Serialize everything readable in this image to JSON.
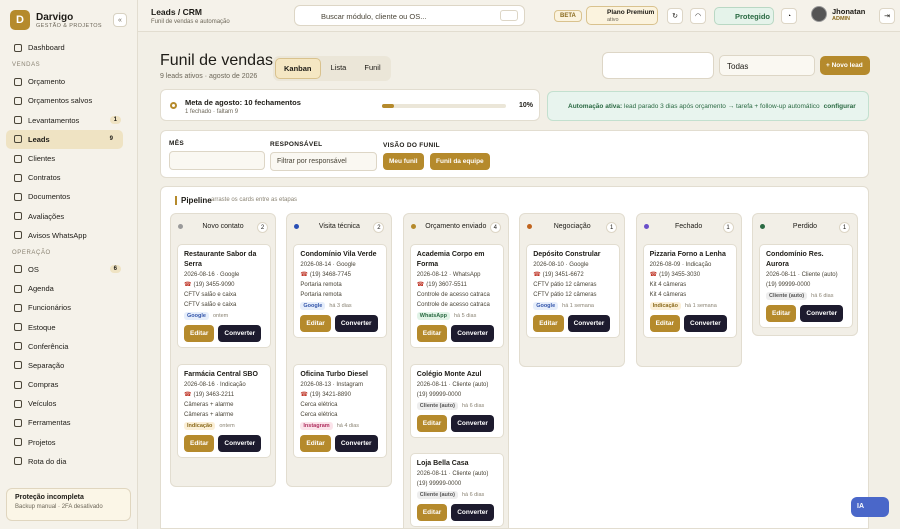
{
  "brand": {
    "name": "Darvigo",
    "sub": "GESTÃO & PROJETOS",
    "logo": "D"
  },
  "sidebar": {
    "top": [
      {
        "label": "Dashboard"
      }
    ],
    "sec1": "VENDAS",
    "vendas": [
      {
        "label": "Orçamento"
      },
      {
        "label": "Orçamentos salvos"
      },
      {
        "label": "Levantamentos",
        "count": "1"
      },
      {
        "label": "Leads",
        "count": "9",
        "active": true
      },
      {
        "label": "Clientes"
      },
      {
        "label": "Contratos"
      },
      {
        "label": "Documentos"
      },
      {
        "label": "Avaliações"
      },
      {
        "label": "Avisos WhatsApp"
      }
    ],
    "sec2": "OPERAÇÃO",
    "operacao": [
      {
        "label": "OS",
        "count": "6"
      },
      {
        "label": "Agenda"
      },
      {
        "label": "Funcionários"
      },
      {
        "label": "Estoque"
      },
      {
        "label": "Conferência"
      },
      {
        "label": "Separação"
      },
      {
        "label": "Compras"
      },
      {
        "label": "Veículos"
      },
      {
        "label": "Ferramentas"
      },
      {
        "label": "Projetos"
      },
      {
        "label": "Rota do dia"
      }
    ],
    "protect_title": "Proteção incompleta",
    "protect_sub": "Backup manual · 2FA desativado"
  },
  "topbar": {
    "crumb": "Leads / CRM",
    "crumb_sub": "Funil de vendas e automação",
    "search": "Buscar módulo, cliente ou OS...",
    "beta": "BETA",
    "plan": "Plano Premium",
    "plan_sub": "ativo",
    "protected": "Protegido",
    "user": "Jhonatan",
    "role": "ADMIN"
  },
  "page": {
    "title": "Funil de vendas",
    "sub": "9 leads ativos · agosto de 2026",
    "tabs": [
      "Kanban",
      "Lista",
      "Funil"
    ],
    "filter": "Todas",
    "new": "+ Novo lead"
  },
  "meta": {
    "title": "Meta de agosto: 10 fechamentos",
    "sub": "1 fechado · faltam 9",
    "pct": "10%",
    "progress": 0.1
  },
  "auto": {
    "bold": "Automação ativa:",
    "text": " lead parado 3 dias após orçamento → tarefa + follow-up automático",
    "link": "configurar"
  },
  "filters": {
    "mes": "MÊS",
    "resp": "RESPONSÁVEL",
    "resp_ph": "Filtrar por responsável",
    "visao": "VISÃO DO FUNIL",
    "meu": "Meu funil",
    "equipe": "Funil da equipe"
  },
  "pipeline": {
    "title": "Pipeline",
    "hint": "arraste os cards entre as etapas",
    "edit": "Editar",
    "convert": "Converter",
    "cols": [
      {
        "name": "Novo contato",
        "count": "2",
        "color": "#9a9a9a",
        "cards": [
          {
            "name": "Restaurante Sabor da Serra",
            "date": "2026-08-16 · Google",
            "phone": "(19) 3455-9090",
            "l1": "CFTV salão e caixa",
            "l2": "CFTV salão e caixa",
            "tag": "Google",
            "ago": "ontem",
            "tc": "#e6eefb",
            "tf": "#3355aa"
          },
          {
            "name": "Farmácia Central SBO",
            "date": "2026-08-16 · Indicação",
            "phone": "(19) 3463-2211",
            "l1": "Câmeras + alarme",
            "l2": "Câmeras + alarme",
            "tag": "Indicação",
            "ago": "ontem",
            "tc": "#fbefd6",
            "tf": "#8a6a1d"
          }
        ]
      },
      {
        "name": "Visita técnica",
        "count": "2",
        "color": "#2a4fb5",
        "cards": [
          {
            "name": "Condomínio Vila Verde",
            "date": "2026-08-14 · Google",
            "phone": "(19) 3468-7745",
            "l1": "Portaria remota",
            "l2": "Portaria remota",
            "tag": "Google",
            "ago": "há 3 dias",
            "tc": "#e6eefb",
            "tf": "#3355aa"
          },
          {
            "name": "Oficina Turbo Diesel",
            "date": "2026-08-13 · Instagram",
            "phone": "(19) 3421-8890",
            "l1": "Cerca elétrica",
            "l2": "Cerca elétrica",
            "tag": "Instagram",
            "ago": "há 4 dias",
            "tc": "#fbe3ea",
            "tf": "#b03060"
          }
        ]
      },
      {
        "name": "Orçamento enviado",
        "count": "4",
        "color": "#b58a2c",
        "cards": [
          {
            "name": "Academia Corpo em Forma",
            "date": "2026-08-12 · WhatsApp",
            "phone": "(19) 3607-5511",
            "l1": "Controle de acesso catraca",
            "l2": "Controle de acesso catraca",
            "tag": "WhatsApp",
            "ago": "há 5 dias",
            "tc": "#e1f3e7",
            "tf": "#2b6a43"
          },
          {
            "name": "Colégio Monte Azul",
            "date": "2026-08-11 · Cliente (auto)",
            "phone": "(19) 99999-0000",
            "tag": "Cliente (auto)",
            "ago": "há 6 dias",
            "tc": "#eeeeee",
            "tf": "#555555",
            "nophone": true
          },
          {
            "name": "Loja Bella Casa",
            "date": "2026-08-11 · Cliente (auto)",
            "phone": "(19) 99999-0000",
            "tag": "Cliente (auto)",
            "ago": "há 6 dias",
            "tc": "#eeeeee",
            "tf": "#555555",
            "nophone": true
          }
        ]
      },
      {
        "name": "Negociação",
        "count": "1",
        "color": "#c0641e",
        "cards": [
          {
            "name": "Depósito Constrular",
            "date": "2026-08-10 · Google",
            "phone": "(19) 3451-6672",
            "l1": "CFTV pátio 12 câmeras",
            "l2": "CFTV pátio 12 câmeras",
            "tag": "Google",
            "ago": "há 1 semana",
            "tc": "#e6eefb",
            "tf": "#3355aa"
          }
        ]
      },
      {
        "name": "Fechado",
        "count": "1",
        "color": "#6a4fc9",
        "cards": [
          {
            "name": "Pizzaria Forno a Lenha",
            "date": "2026-08-09 · Indicação",
            "phone": "(19) 3455-3030",
            "l1": "Kit 4 câmeras",
            "l2": "Kit 4 câmeras",
            "tag": "Indicação",
            "ago": "há 1 semana",
            "tc": "#fbefd6",
            "tf": "#8a6a1d"
          }
        ]
      },
      {
        "name": "Perdido",
        "count": "1",
        "color": "#2b6a43",
        "cards": [
          {
            "name": "Condomínio Res. Aurora",
            "date": "2026-08-11 · Cliente (auto)",
            "phone": "(19) 99999-0000",
            "tag": "Cliente (auto)",
            "ago": "há 6 dias",
            "tc": "#eeeeee",
            "tf": "#555555",
            "nophone": true
          }
        ]
      }
    ]
  },
  "ai": "IA"
}
